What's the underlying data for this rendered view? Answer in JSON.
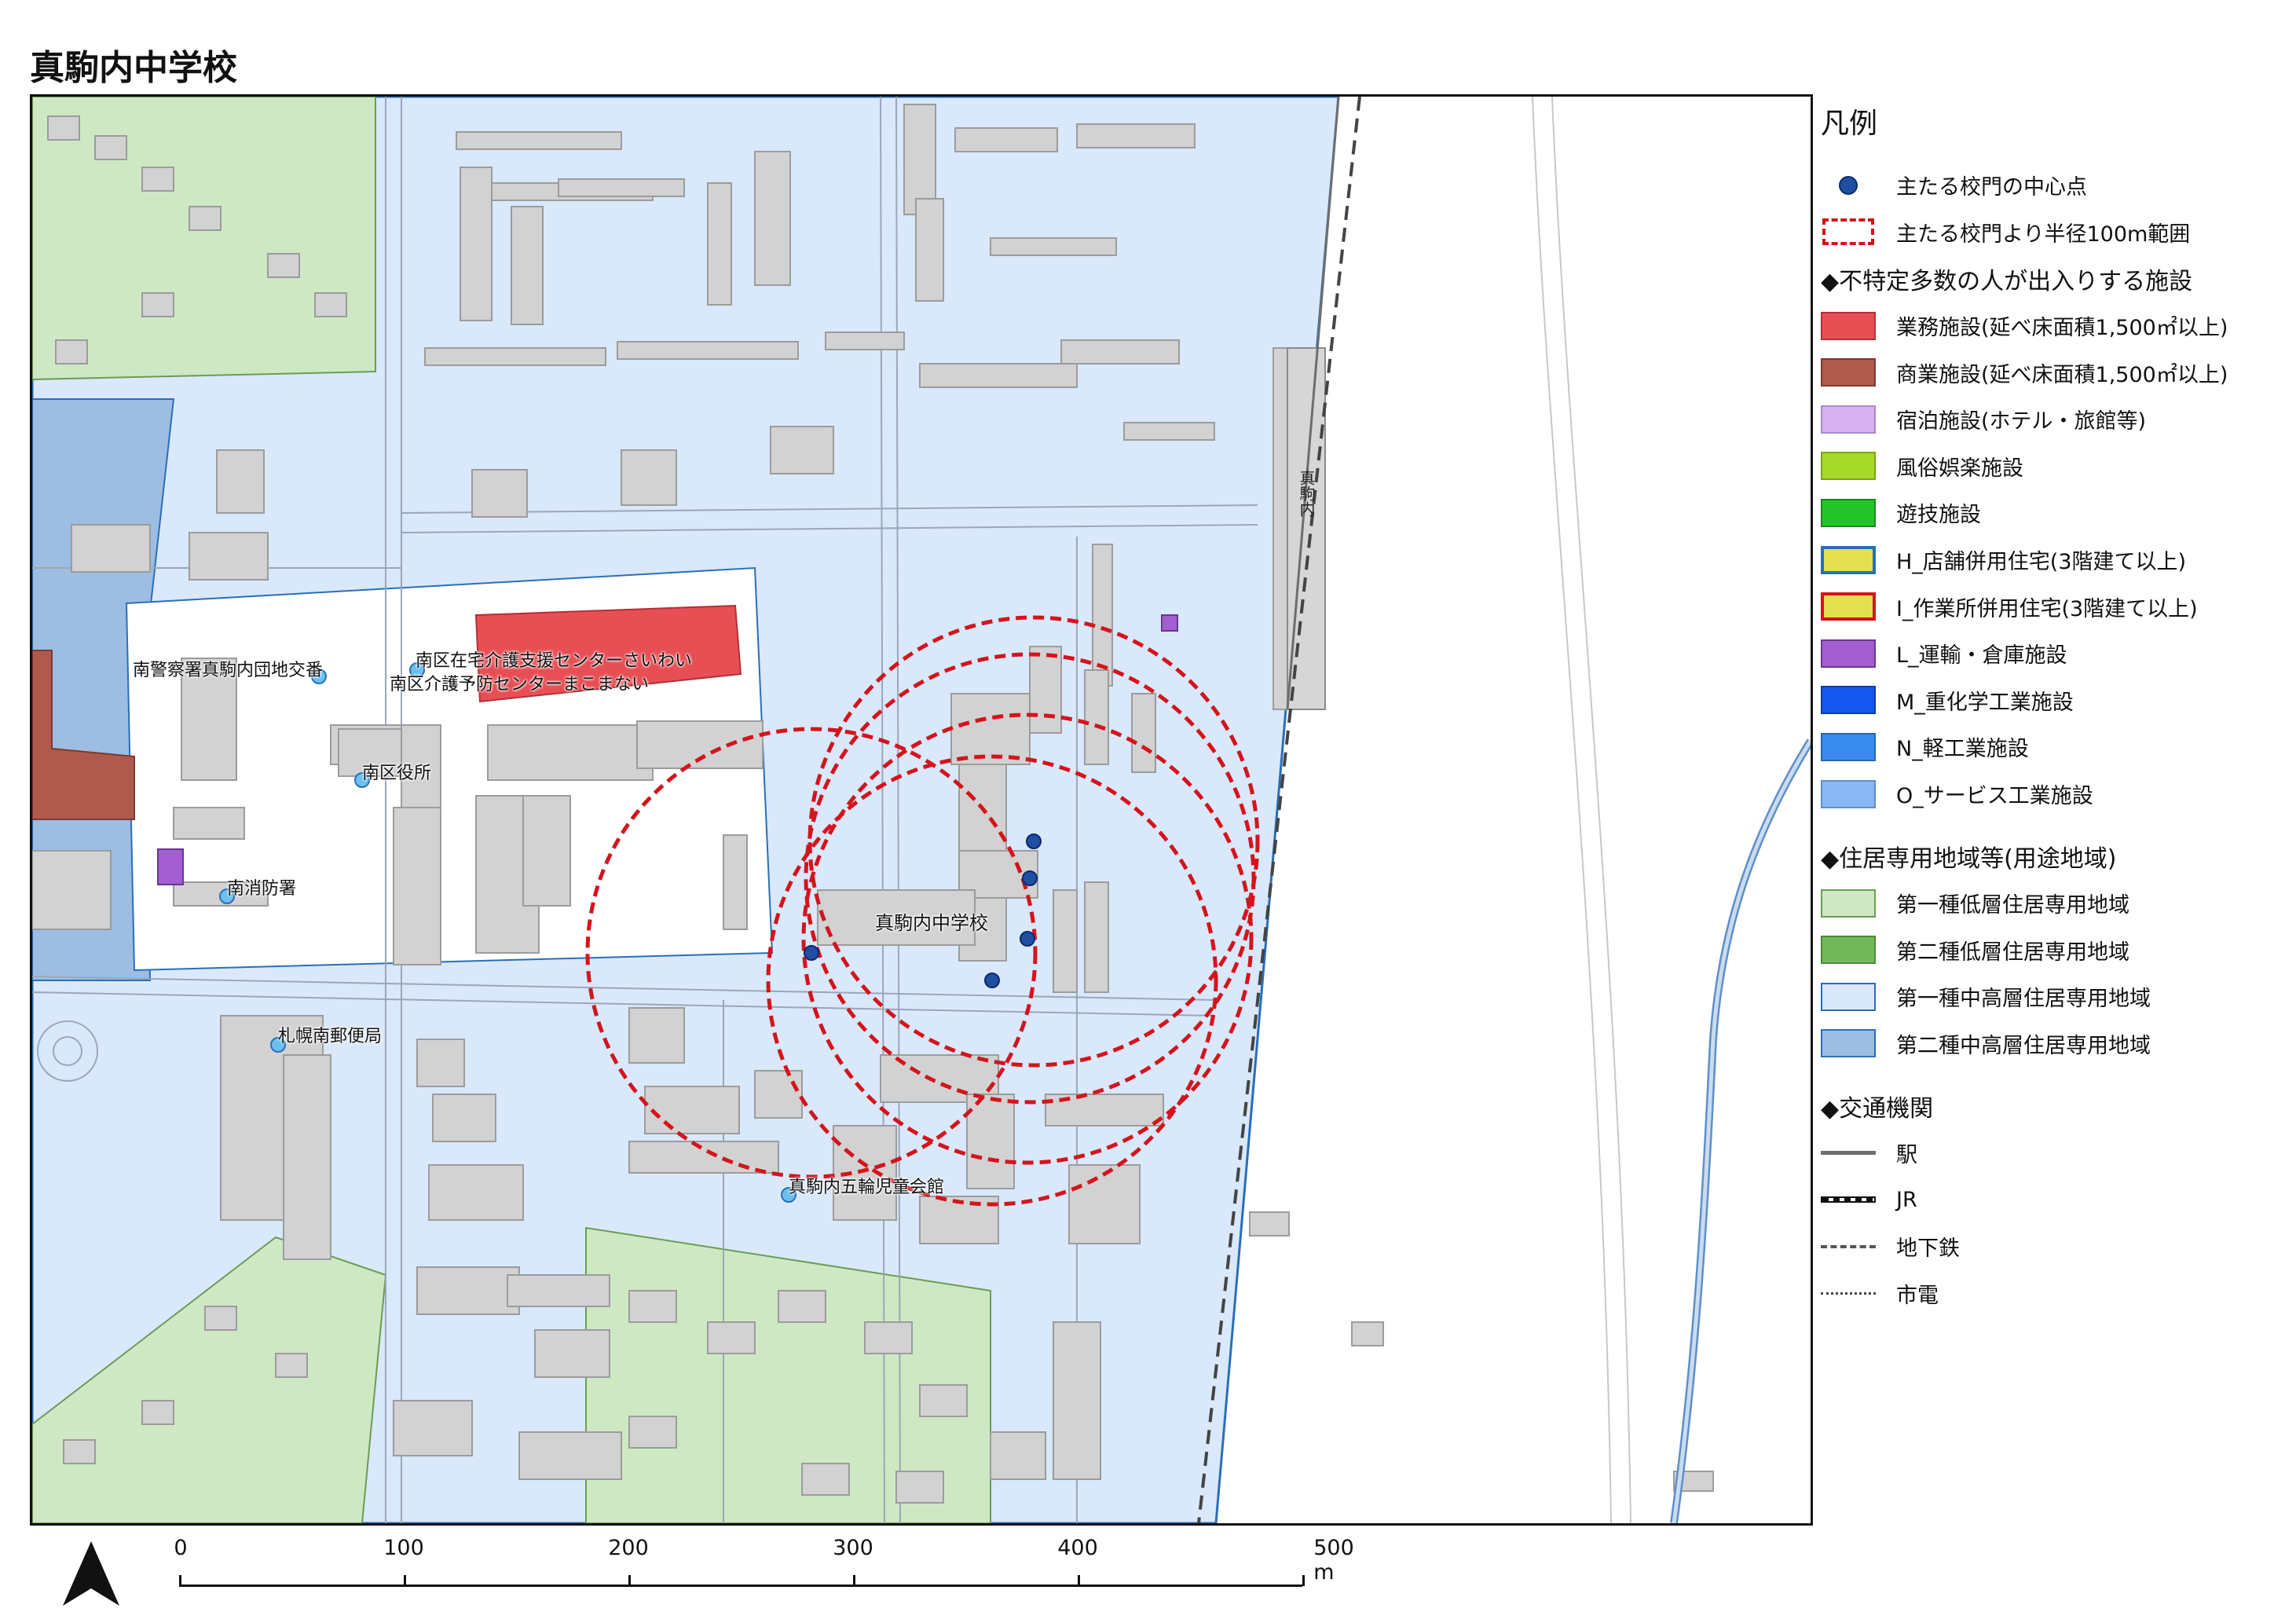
{
  "title": "真駒内中学校",
  "map_labels": {
    "school": "真駒内中学校",
    "police": "南警察署真駒内団地交番",
    "care1": "南区在宅介護支援センターさいわい",
    "care2": "南区介護予防センターまこまない",
    "ward_office": "南区役所",
    "fire": "南消防署",
    "post": "札幌南郵便局",
    "community": "真駒内五輪児童会館",
    "station": "真駒内"
  },
  "legend": {
    "title": "凡例",
    "gate_center": "主たる校門の中心点",
    "radius": "主たる校門より半径100m範囲",
    "section_facilities": "◆不特定多数の人が出入りする施設",
    "business": "業務施設(延べ床面積1,500㎡以上)",
    "commercial": "商業施設(延べ床面積1,500㎡以上)",
    "lodging": "宿泊施設(ホテル・旅館等)",
    "adult": "風俗娯楽施設",
    "game": "遊技施設",
    "h_shop": "H_店舗併用住宅(3階建て以上)",
    "i_work": "I_作業所併用住宅(3階建て以上)",
    "l_transport": "L_運輸・倉庫施設",
    "m_heavy": "M_重化学工業施設",
    "n_light": "N_軽工業施設",
    "o_service": "O_サービス工業施設",
    "section_zones": "◆住居専用地域等(用途地域)",
    "zone1_low": "第一種低層住居専用地域",
    "zone2_low": "第二種低層住居専用地域",
    "zone1_mid": "第一種中高層住居専用地域",
    "zone2_mid": "第二種中高層住居専用地域",
    "section_transport": "◆交通機関",
    "station": "駅",
    "jr": "JR",
    "subway": "地下鉄",
    "tram": "市電"
  },
  "colors": {
    "business": "#e84f55",
    "commercial": "#b05a4e",
    "lodging": "#d6b2f2",
    "adult": "#a6d928",
    "game": "#23c42b",
    "h_fill": "#e2e04f",
    "h_border": "#2a6fb8",
    "i_fill": "#e2e04f",
    "i_border": "#d4141c",
    "l_transport": "#a35fd1",
    "m_heavy": "#1556f0",
    "n_light": "#3a8bef",
    "o_service": "#8bb8f4",
    "zone1_low": "#cfe8c4",
    "zone2_low": "#72b95a",
    "zone1_mid": "#d9e8fb",
    "zone2_mid": "#9dbde3",
    "gate": "#1f4fa3",
    "radius": "#d4141c",
    "building": "#d2d2d2"
  },
  "scale": {
    "ticks": [
      "0",
      "100",
      "200",
      "300",
      "400",
      "500 m"
    ]
  }
}
